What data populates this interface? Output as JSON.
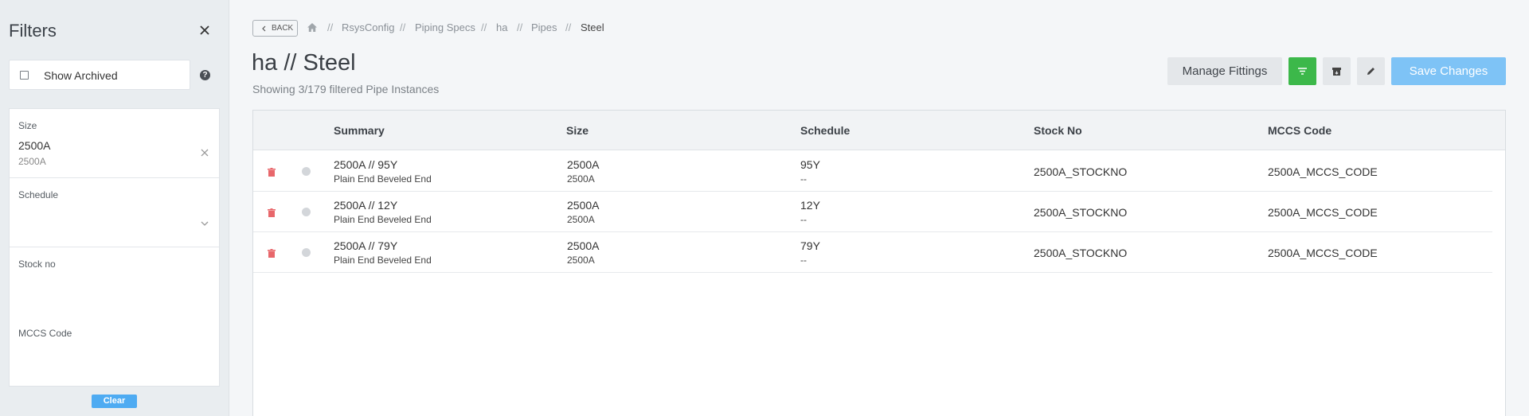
{
  "sidebar": {
    "title": "Filters",
    "show_archived_label": "Show Archived",
    "size": {
      "label": "Size",
      "value": "2500A",
      "sub": "2500A"
    },
    "schedule": {
      "label": "Schedule"
    },
    "stock_no": {
      "label": "Stock no"
    },
    "mccs_code": {
      "label": "MCCS Code"
    },
    "clear_label": "Clear"
  },
  "header": {
    "back_label": "BACK",
    "breadcrumbs": [
      "RsysConfig",
      "Piping Specs",
      "ha",
      "Pipes",
      "Steel"
    ],
    "separator": "//",
    "title": "ha // Steel",
    "subtitle": "Showing 3/179 filtered Pipe Instances"
  },
  "toolbar": {
    "manage_fittings_label": "Manage Fittings",
    "save_label": "Save Changes"
  },
  "colors": {
    "filter_button": "#3cb84a",
    "save_button": "#7ec3f6",
    "delete_icon": "#e8676b",
    "clear_button": "#4eabf2"
  },
  "table": {
    "columns": [
      "Summary",
      "Size",
      "Schedule",
      "Stock No",
      "MCCS Code"
    ],
    "rows": [
      {
        "summary": "2500A // 95Y",
        "summary_sub": "Plain End Beveled End",
        "size": "2500A",
        "size_sub": "2500A",
        "schedule": "95Y",
        "schedule_sub": "--",
        "stock_no": "2500A_STOCKNO",
        "mccs_code": "2500A_MCCS_CODE"
      },
      {
        "summary": "2500A // 12Y",
        "summary_sub": "Plain End Beveled End",
        "size": "2500A",
        "size_sub": "2500A",
        "schedule": "12Y",
        "schedule_sub": "--",
        "stock_no": "2500A_STOCKNO",
        "mccs_code": "2500A_MCCS_CODE"
      },
      {
        "summary": "2500A // 79Y",
        "summary_sub": "Plain End Beveled End",
        "size": "2500A",
        "size_sub": "2500A",
        "schedule": "79Y",
        "schedule_sub": "--",
        "stock_no": "2500A_STOCKNO",
        "mccs_code": "2500A_MCCS_CODE"
      }
    ]
  }
}
